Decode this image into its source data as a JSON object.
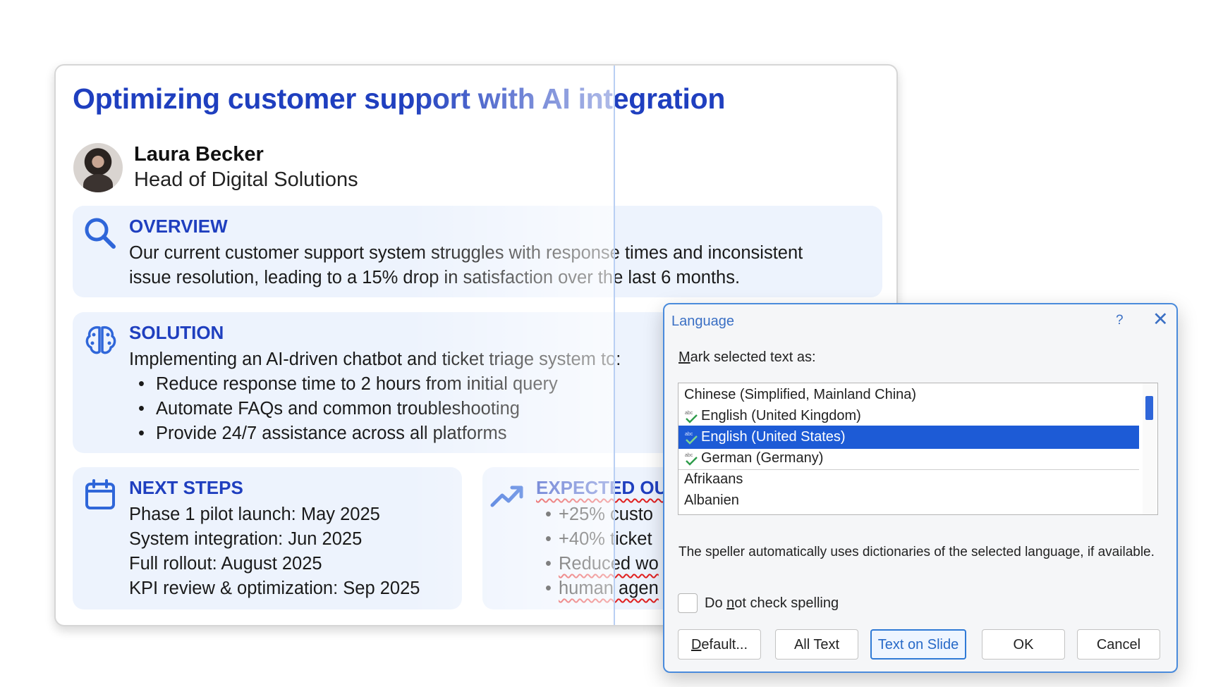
{
  "slide": {
    "title": "Optimizing customer support with AI integration",
    "author": {
      "name": "Laura Becker",
      "role": "Head of Digital Solutions"
    },
    "overview": {
      "heading": "OVERVIEW",
      "line1": "Our current customer support system struggles with response times and inconsistent",
      "line2": "issue resolution, leading to a 15% drop in satisfaction over the last 6 months."
    },
    "solution": {
      "heading": "SOLUTION",
      "intro": "Implementing an AI-driven chatbot and ticket triage system to:",
      "bullets": [
        "Reduce response time to 2 hours from initial query",
        "Automate FAQs and common troubleshooting",
        "Provide 24/7 assistance across all platforms"
      ]
    },
    "next_steps": {
      "heading": "NEXT STEPS",
      "lines": [
        "Phase 1 pilot launch: May 2025",
        "System integration: Jun 2025",
        "Full rollout: August 2025",
        "KPI review & optimization: Sep 2025"
      ]
    },
    "expected": {
      "heading": "EXPECTED OU",
      "bullets": [
        "+25% custo",
        "+40% ticket",
        "Reduced wo"
      ],
      "continuation": "human agen"
    }
  },
  "dialog": {
    "title": "Language",
    "help": "?",
    "close": "✕",
    "label_first": "M",
    "label_rest": "ark selected text as:",
    "languages": [
      {
        "name": "Chinese (Simplified, Mainland China)",
        "spell": false,
        "selected": false
      },
      {
        "name": "English (United Kingdom)",
        "spell": true,
        "selected": false
      },
      {
        "name": "English (United States)",
        "spell": true,
        "selected": true
      },
      {
        "name": "German (Germany)",
        "spell": true,
        "selected": false
      },
      {
        "name": "Afrikaans",
        "spell": false,
        "selected": false
      },
      {
        "name": "Albanien",
        "spell": false,
        "selected": false
      }
    ],
    "info": "The speller automatically uses dictionaries of the selected language, if available.",
    "checkbox_pre": "Do ",
    "checkbox_ul": "n",
    "checkbox_post": "ot check spelling",
    "checkbox_checked": false,
    "buttons": {
      "default_ul": "D",
      "default_rest": "efault...",
      "all_text": "All Text",
      "text_on_slide": "Text on Slide",
      "ok": "OK",
      "cancel": "Cancel"
    },
    "colors": {
      "accent": "#1d5bd6",
      "title": "#3a6fc4",
      "spell_check": "#2e9c4a"
    }
  }
}
